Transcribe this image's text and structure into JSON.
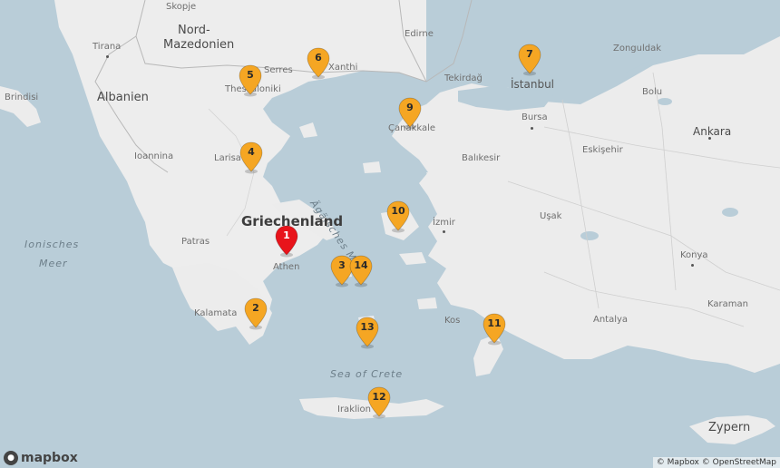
{
  "labels": {
    "skopje": "Skopje",
    "nord_mazedonien_1": "Nord-",
    "nord_mazedonien_2": "Mazedonien",
    "tirana": "Tirana",
    "albanien": "Albanien",
    "brindisi": "Brindisi",
    "edirne": "Edirne",
    "serres": "Serres",
    "xanthi": "Xanthi",
    "thessaloniki": "Thessaloniki",
    "tekirdag": "Tekirdağ",
    "istanbul": "İstanbul",
    "zonguldak": "Zonguldak",
    "bolu": "Bolu",
    "bursa": "Bursa",
    "canakkale": "Çanakkale",
    "ankara": "Ankara",
    "eskisehir": "Eskişehir",
    "ioannina": "Ioannina",
    "larisa": "Larisa",
    "balikesir": "Balıkesir",
    "aegaeisches_meer": "Ägäisches Meer",
    "ionisches_1": "Ionisches",
    "ionisches_2": "Meer",
    "griechenland": "Griechenland",
    "izmir": "İzmir",
    "usak": "Uşak",
    "patras": "Patras",
    "athen": "Athen",
    "konya": "Konya",
    "kalamata": "Kalamata",
    "kos": "Kos",
    "antalya": "Antalya",
    "karaman": "Karaman",
    "sea_of_crete": "Sea of Crete",
    "iraklion": "Iraklion",
    "zypern": "Zypern"
  },
  "markers": [
    {
      "id": "1",
      "label": "1",
      "color": "#e8141b"
    },
    {
      "id": "2",
      "label": "2",
      "color": "#f5a623"
    },
    {
      "id": "3",
      "label": "3",
      "color": "#f5a623"
    },
    {
      "id": "4",
      "label": "4",
      "color": "#f5a623"
    },
    {
      "id": "5",
      "label": "5",
      "color": "#f5a623"
    },
    {
      "id": "6",
      "label": "6",
      "color": "#f5a623"
    },
    {
      "id": "7",
      "label": "7",
      "color": "#f5a623"
    },
    {
      "id": "9",
      "label": "9",
      "color": "#f5a623"
    },
    {
      "id": "10",
      "label": "10",
      "color": "#f5a623"
    },
    {
      "id": "11",
      "label": "11",
      "color": "#f5a623"
    },
    {
      "id": "12",
      "label": "12",
      "color": "#f5a623"
    },
    {
      "id": "13",
      "label": "13",
      "color": "#f5a623"
    },
    {
      "id": "14",
      "label": "14",
      "color": "#f5a623"
    }
  ],
  "footer": {
    "logo_text": "mapbox",
    "attribution": "© Mapbox © OpenStreetMap"
  },
  "colors": {
    "water": "#b9cdd8",
    "land": "#efefef",
    "border": "#b0b0b0",
    "marker_default": "#f5a623",
    "marker_highlight": "#e8141b"
  }
}
